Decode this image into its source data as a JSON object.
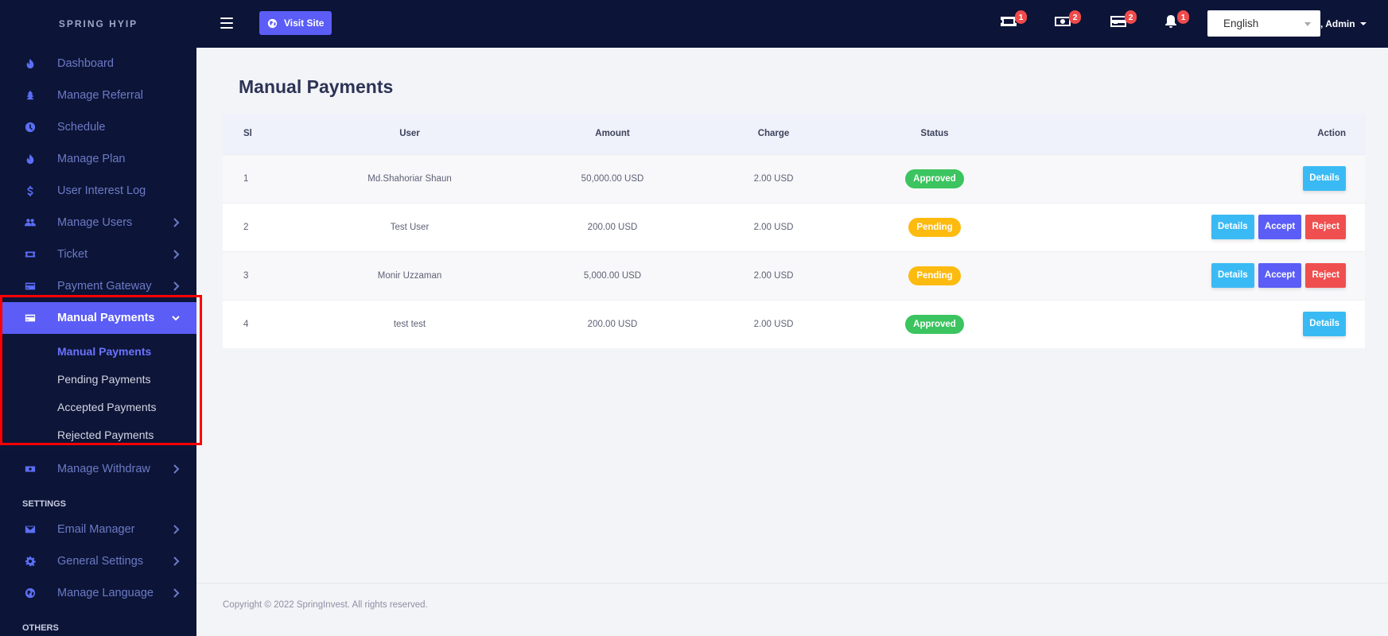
{
  "brand": "SPRING HYIP",
  "sidebar": {
    "items": [
      {
        "label": "Dashboard",
        "icon": "fire-icon"
      },
      {
        "label": "Manage Referral",
        "icon": "tree-icon"
      },
      {
        "label": "Schedule",
        "icon": "clock-icon"
      },
      {
        "label": "Manage Plan",
        "icon": "fire-icon"
      },
      {
        "label": "User Interest Log",
        "icon": "dollar-icon"
      },
      {
        "label": "Manage Users",
        "icon": "users-icon"
      },
      {
        "label": "Ticket",
        "icon": "ticket-icon"
      },
      {
        "label": "Payment Gateway",
        "icon": "credit-card-icon"
      },
      {
        "label": "Manual Payments",
        "icon": "credit-card-icon"
      }
    ],
    "manual_submenu": [
      "Manual Payments",
      "Pending Payments",
      "Accepted Payments",
      "Rejected Payments"
    ],
    "after_items": [
      {
        "label": "Manage Withdraw",
        "icon": "money-icon"
      }
    ],
    "settings_title": "SETTINGS",
    "settings_items": [
      {
        "label": "Email Manager",
        "icon": "envelope-icon"
      },
      {
        "label": "General Settings",
        "icon": "gear-icon"
      },
      {
        "label": "Manage Language",
        "icon": "globe-icon"
      }
    ],
    "others_title": "OTHERS"
  },
  "topbar": {
    "visit_site": "Visit Site",
    "badges": {
      "ticket": "1",
      "money": "2",
      "card": "2",
      "bell": "1"
    },
    "language": "English",
    "admin": "Hi, Admin"
  },
  "main": {
    "title": "Manual Payments",
    "columns": [
      "Sl",
      "User",
      "Amount",
      "Charge",
      "Status",
      "Action"
    ],
    "rows": [
      {
        "sl": "1",
        "user": "Md.Shahoriar Shaun",
        "amount": "50,000.00 USD",
        "charge": "2.00 USD",
        "status": "Approved"
      },
      {
        "sl": "2",
        "user": "Test User",
        "amount": "200.00 USD",
        "charge": "2.00 USD",
        "status": "Pending"
      },
      {
        "sl": "3",
        "user": "Monir Uzzaman",
        "amount": "5,000.00 USD",
        "charge": "2.00 USD",
        "status": "Pending"
      },
      {
        "sl": "4",
        "user": "test test",
        "amount": "200.00 USD",
        "charge": "2.00 USD",
        "status": "Approved"
      }
    ],
    "actions": {
      "details": "Details",
      "accept": "Accept",
      "reject": "Reject"
    }
  },
  "footer": "Copyright © 2022 SpringInvest. All rights reserved.",
  "colors": {
    "sidebar_bg": "#0c1438",
    "accent": "#5b5df6",
    "approved": "#3bc45f",
    "pending": "#fdba0f",
    "details": "#3abaf4",
    "reject": "#f04f4f"
  }
}
